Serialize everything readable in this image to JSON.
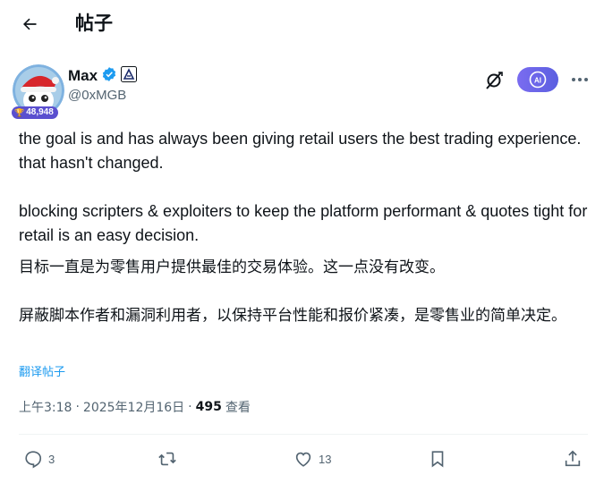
{
  "header": {
    "title": "帖子"
  },
  "author": {
    "display_name": "Max",
    "handle": "@0xMGB",
    "badge_count": "48,948"
  },
  "tweet": {
    "paragraph_1": "the goal is and has always been giving retail users the best trading experience. that hasn't changed.",
    "paragraph_2": "blocking scripters & exploiters to keep the platform performant & quotes tight for retail is an easy decision.",
    "cn_paragraph_1": "目标一直是为零售用户提供最佳的交易体验。这一点没有改变。",
    "cn_paragraph_2": "屏蔽脚本作者和漏洞利用者，以保持平台性能和报价紧凑，是零售业的简单决定。",
    "translate_label": "翻译帖子"
  },
  "meta": {
    "time": "上午3:18",
    "date": "2025年12月16日",
    "separator": "·",
    "views": "495",
    "views_label": "查看"
  },
  "actions": {
    "replies": "3",
    "likes": "13"
  },
  "ai_button_label": "AI",
  "colors": {
    "accent": "#1d9bf0",
    "ai_button": "#6c63f0",
    "secondary_text": "#536471"
  }
}
